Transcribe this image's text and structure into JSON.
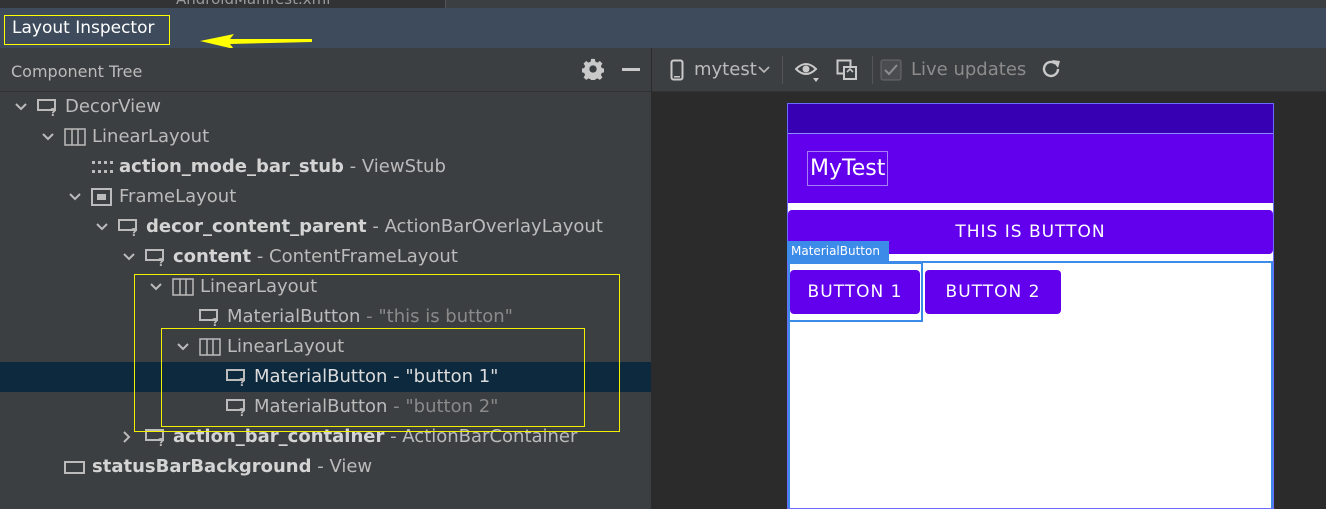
{
  "top_tab": {
    "label": "AndroidManifest.xml"
  },
  "window_title": "Layout Inspector",
  "component_tree": {
    "title": "Component Tree",
    "rows": [
      {
        "name": "DecorView",
        "detail": ""
      },
      {
        "name": "LinearLayout",
        "detail": ""
      },
      {
        "name": "action_mode_bar_stub",
        "detail": " - ViewStub"
      },
      {
        "name": "FrameLayout",
        "detail": ""
      },
      {
        "name": "decor_content_parent",
        "detail": " - ActionBarOverlayLayout"
      },
      {
        "name": "content",
        "detail": " - ContentFrameLayout"
      },
      {
        "name": "LinearLayout",
        "detail": ""
      },
      {
        "name": "MaterialButton",
        "detail": " - \"this is button\""
      },
      {
        "name": "LinearLayout",
        "detail": ""
      },
      {
        "name": "MaterialButton",
        "detail": " - \"button 1\""
      },
      {
        "name": "MaterialButton",
        "detail": " - \"button 2\""
      },
      {
        "name": "action_bar_container",
        "detail": " - ActionBarContainer"
      },
      {
        "name": "statusBarBackground",
        "detail": " - View"
      }
    ]
  },
  "toolbar": {
    "device": "mytest",
    "live_updates": "Live updates"
  },
  "preview": {
    "app_title": "MyTest",
    "big_button": "THIS IS BUTTON",
    "button1": "BUTTON 1",
    "button2": "BUTTON 2",
    "selection_tag": "MaterialButton"
  },
  "colors": {
    "primary": "#6200ee",
    "primary_dark": "#3700b3",
    "highlight": "#ffff00",
    "selection": "#3d8be8"
  }
}
